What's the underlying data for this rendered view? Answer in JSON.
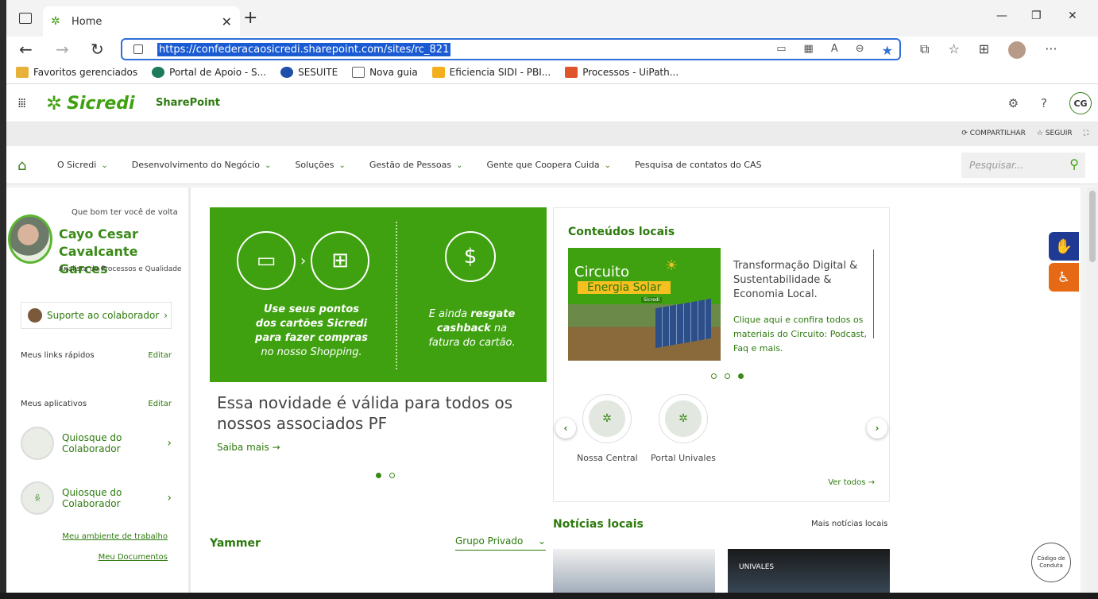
{
  "browser": {
    "tab_title": "Home",
    "url": "https://confederacaosicredi.sharepoint.com/sites/rc_821",
    "bookmarks": [
      {
        "label": "Favoritos gerenciados",
        "color": "#e8b23a"
      },
      {
        "label": "Portal de Apoio - S...",
        "color": "#1d7a5c"
      },
      {
        "label": "SESUITE",
        "color": "#1f4fa8"
      },
      {
        "label": "Nova guia",
        "color": "#666666"
      },
      {
        "label": "Eficiencia SIDI - PBI...",
        "color": "#f2b01e"
      },
      {
        "label": "Processos - UiPath...",
        "color": "#e0542b"
      }
    ]
  },
  "suite": {
    "brand": "Sicredi",
    "app_label": "SharePoint",
    "user_initials": "CG"
  },
  "command_bar": {
    "share": "COMPARTILHAR",
    "follow": "SEGUIR"
  },
  "nav": {
    "items": [
      {
        "label": "O Sicredi"
      },
      {
        "label": "Desenvolvimento do Negócio"
      },
      {
        "label": "Soluções"
      },
      {
        "label": "Gestão de Pessoas"
      },
      {
        "label": "Gente que Coopera Cuida"
      },
      {
        "label": "Pesquisa de contatos do CAS"
      }
    ],
    "search_placeholder": "Pesquisar..."
  },
  "sidebar": {
    "welcome": "Que bom ter você de volta",
    "name_line1": "Cayo Cesar",
    "name_line2": "Cavalcante Garces",
    "role": "Analista de Processos e Qualidade",
    "support": "Suporte ao colaborador",
    "quick_links": "Meus links rápidos",
    "apps": "Meus aplicativos",
    "edit": "Editar",
    "app_items": [
      {
        "line1": "Quiosque do",
        "line2": "Colaborador"
      },
      {
        "line1": "Quiosque do",
        "line2": "Colaborador"
      }
    ],
    "workspace_link": "Meu ambiente de trabalho",
    "documents_link": "Meu Documentos"
  },
  "hero": {
    "left_bold1": "Use seus pontos",
    "left_bold2": "dos cartões Sicredi",
    "left_bold3": "para fazer compras",
    "left_regular": "no nosso Shopping.",
    "right_line1a": "E ainda ",
    "right_line1b": "resgate",
    "right_line2a": "cashback",
    "right_line2b": " na",
    "right_line3": "fatura do cartão.",
    "caption": "Essa novidade é válida para todos os nossos associados PF",
    "saiba": "Saiba mais"
  },
  "local_content": {
    "title": "Conteúdos locais",
    "img_line1": "Circuito",
    "img_line2": "Energia Solar",
    "img_brand": "Sicredi",
    "feature_text": "Transformação Digital & Sustentabilidade & Economia Local.",
    "feature_link": "Clique aqui e confira todos os materiais do Circuito: Podcast, Faq e mais.",
    "quick_links": [
      {
        "label": "Nossa Central"
      },
      {
        "label": "Portal Univales"
      }
    ],
    "ver_todos": "Ver todos"
  },
  "yammer": {
    "title": "Yammer",
    "group": "Grupo Privado"
  },
  "news": {
    "title": "Notícias locais",
    "more": "Mais notícias locais",
    "card2_tag": "UNIVALES"
  },
  "codigo": "Código de Conduta"
}
